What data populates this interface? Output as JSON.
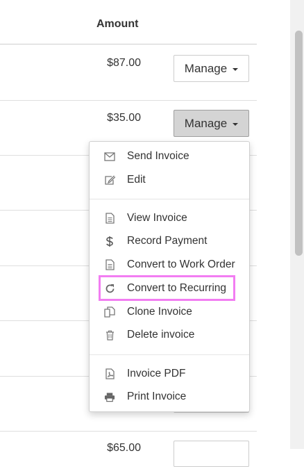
{
  "table": {
    "amount_header": "Amount",
    "rows": [
      {
        "amount": "$87.00",
        "button_label": "Manage"
      },
      {
        "amount": "$35.00",
        "button_label": "Manage"
      },
      {
        "amount": "$65.00",
        "button_label": ""
      }
    ]
  },
  "menu": {
    "groups": [
      [
        {
          "label": "Send Invoice",
          "icon": "envelope-icon"
        },
        {
          "label": "Edit",
          "icon": "edit-icon"
        }
      ],
      [
        {
          "label": "View Invoice",
          "icon": "file-icon"
        },
        {
          "label": "Record Payment",
          "icon": "dollar-icon"
        },
        {
          "label": "Convert to Work Order",
          "icon": "file-icon"
        },
        {
          "label": "Convert to Recurring",
          "icon": "redo-icon"
        },
        {
          "label": "Clone Invoice",
          "icon": "copy-icon"
        },
        {
          "label": "Delete invoice",
          "icon": "trash-icon"
        }
      ],
      [
        {
          "label": "Invoice PDF",
          "icon": "pdf-icon"
        },
        {
          "label": "Print Invoice",
          "icon": "print-icon"
        }
      ]
    ],
    "highlighted_item": "Convert to Recurring",
    "highlight_color": "#f27df2"
  }
}
